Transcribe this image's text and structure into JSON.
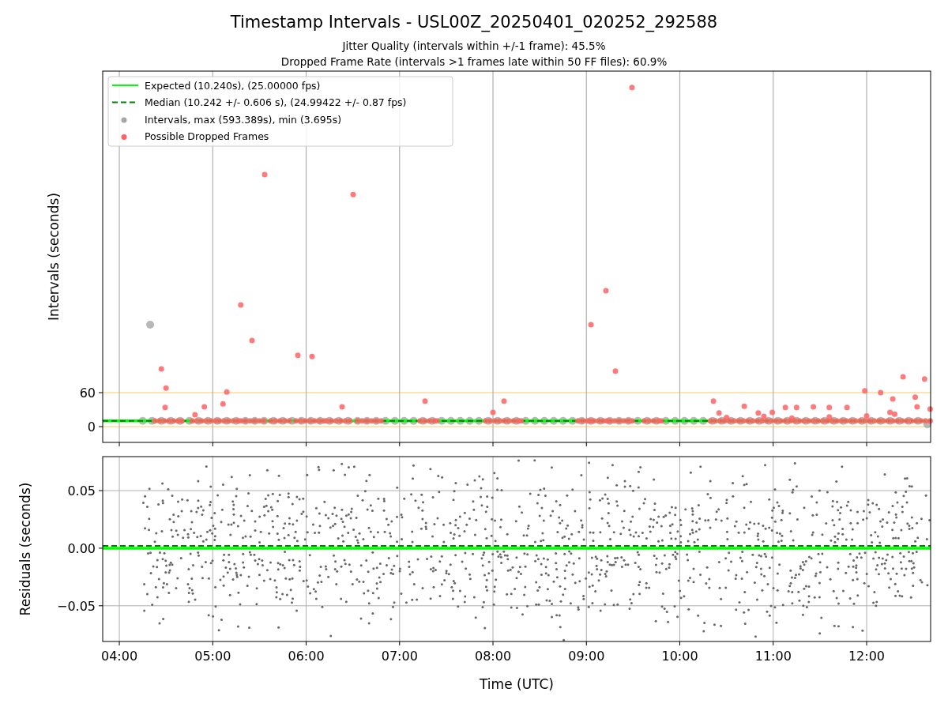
{
  "figure": {
    "title": "Timestamp Intervals - USL00Z_20250401_020252_292588",
    "subtitles": [
      "Jitter Quality (intervals within +/-1 frame): 45.5%",
      "Dropped Frame Rate (intervals >1 frames late within 50 FF files): 60.9%"
    ]
  },
  "intervals_plot": {
    "chart_data": {
      "type": "scatter",
      "ylabel": "Intervals (seconds)",
      "grid": "x",
      "legend": true,
      "xlim": [
        3.822,
        12.685
      ],
      "ylim": [
        -27.9,
        627.9
      ],
      "yticks": [
        {
          "value": 0,
          "label": "0"
        },
        {
          "value": 60,
          "label": "60"
        }
      ],
      "series": [
        {
          "name": "Intervals, max (593.389s), min (3.695s)",
          "color": "#a6a6a6",
          "x": [
            4.25,
            4.35,
            4.45,
            4.55,
            4.65,
            4.75,
            4.85,
            4.95,
            5.05,
            5.15,
            5.25,
            5.35,
            5.45,
            5.55,
            5.65,
            5.75,
            5.85,
            5.95,
            6.05,
            6.15,
            6.25,
            6.35,
            6.45,
            6.55,
            6.65,
            6.75,
            6.85,
            6.95,
            7.05,
            7.15,
            7.25,
            7.35,
            7.45,
            7.55,
            7.65,
            7.75,
            7.85,
            7.95,
            8.05,
            8.15,
            8.25,
            8.35,
            8.45,
            8.55,
            8.65,
            8.75,
            8.85,
            8.95,
            9.05,
            9.15,
            9.25,
            9.35,
            9.45,
            9.55,
            9.65,
            9.75,
            9.85,
            9.95,
            10.05,
            10.15,
            10.25,
            10.35,
            10.45,
            10.55,
            10.65,
            10.75,
            10.85,
            10.95,
            11.05,
            11.15,
            11.25,
            11.35,
            11.45,
            11.55,
            11.65,
            11.75,
            11.85,
            11.95,
            12.05,
            12.15,
            12.25,
            12.35,
            12.45,
            12.55,
            12.65,
            4.33
          ],
          "values": [
            10,
            10,
            10,
            10,
            10,
            10,
            10,
            10,
            10,
            10,
            10,
            10,
            10,
            10,
            10,
            10,
            10,
            10,
            10,
            10,
            10,
            10,
            10,
            10,
            10,
            10,
            10,
            10,
            10,
            10,
            10,
            10,
            10,
            10,
            10,
            10,
            10,
            10,
            10,
            10,
            10,
            10,
            10,
            10,
            10,
            10,
            10,
            10,
            10,
            10,
            10,
            10,
            10,
            10,
            10,
            10,
            10,
            10,
            10,
            10,
            10,
            10,
            10,
            10,
            10,
            10,
            10,
            10,
            10,
            10,
            10,
            10,
            10,
            10,
            10,
            10,
            10,
            10,
            10,
            10,
            10,
            10,
            10,
            10,
            4,
            180
          ]
        },
        {
          "name": "Possible Dropped Frames",
          "color": "#ff6464",
          "x": [
            4.38,
            4.43,
            4.48,
            4.53,
            4.58,
            4.63,
            4.67,
            4.78,
            4.83,
            4.88,
            4.93,
            4.98,
            5.03,
            5.07,
            5.12,
            5.17,
            5.22,
            5.27,
            5.3,
            5.35,
            5.4,
            5.45,
            5.5,
            5.55,
            5.62,
            5.67,
            5.72,
            5.77,
            5.82,
            5.89,
            5.94,
            5.99,
            6.04,
            6.09,
            6.14,
            6.19,
            6.22,
            6.27,
            6.32,
            6.37,
            6.42,
            6.47,
            6.55,
            6.6,
            6.65,
            6.7,
            6.75,
            6.8,
            7.22,
            7.27,
            7.32,
            7.37,
            7.4,
            7.92,
            7.97,
            8.02,
            8.07,
            8.12,
            8.17,
            8.22,
            8.27,
            8.3,
            8.91,
            8.96,
            9.01,
            9.04,
            9.08,
            9.13,
            9.18,
            9.22,
            9.25,
            9.3,
            9.35,
            9.4,
            9.45,
            9.49,
            9.62,
            9.67,
            9.72,
            9.77,
            9.8,
            10.33,
            10.38,
            10.43,
            10.48,
            10.53,
            10.58,
            10.63,
            10.68,
            10.73,
            10.78,
            10.83,
            10.88,
            10.93,
            10.98,
            11.03,
            11.08,
            11.13,
            11.18,
            11.23,
            11.28,
            11.33,
            11.38,
            11.43,
            11.48,
            11.53,
            11.58,
            11.63,
            11.68,
            11.73,
            11.78,
            11.83,
            11.88,
            11.93,
            11.98,
            12.03,
            12.08,
            12.13,
            12.18,
            12.23,
            12.28,
            12.33,
            12.38,
            12.43,
            12.48,
            12.53,
            12.58,
            12.63,
            12.68,
            10.5,
            10.9,
            11.2,
            11.6,
            12.0,
            12.3,
            12.25,
            4.45,
            4.5,
            4.49,
            4.81,
            4.91,
            5.11,
            5.15,
            5.3,
            5.42,
            5.556,
            5.911,
            6.063,
            6.385,
            6.503,
            7.273,
            8.0,
            8.118,
            9.049,
            9.209,
            9.311,
            9.488,
            10.36,
            10.42,
            10.69,
            10.84,
            10.99,
            11.13,
            11.25,
            11.43,
            11.6,
            11.79,
            11.98,
            12.15,
            12.28,
            12.39,
            12.52,
            12.62,
            12.68,
            12.54
          ],
          "values": [
            10,
            10,
            10,
            10,
            10,
            10,
            10,
            10,
            10,
            10,
            10,
            10,
            10,
            10,
            10,
            10,
            10,
            10,
            10,
            10,
            10,
            10,
            10,
            10,
            10,
            10,
            10,
            10,
            10,
            10,
            10,
            10,
            10,
            10,
            10,
            10,
            10,
            10,
            10,
            10,
            10,
            10,
            10,
            10,
            10,
            10,
            10,
            10,
            10,
            10,
            10,
            10,
            10,
            10,
            10,
            10,
            10,
            10,
            10,
            10,
            10,
            10,
            10,
            10,
            10,
            10,
            10,
            10,
            10,
            10,
            10,
            10,
            10,
            10,
            10,
            10,
            10,
            10,
            10,
            10,
            10,
            10,
            10,
            10,
            10,
            10,
            10,
            10,
            10,
            10,
            10,
            10,
            10,
            10,
            10,
            10,
            10,
            10,
            10,
            10,
            10,
            10,
            10,
            10,
            10,
            10,
            10,
            10,
            10,
            10,
            10,
            10,
            10,
            10,
            10,
            10,
            10,
            10,
            10,
            10,
            10,
            10,
            10,
            10,
            10,
            10,
            10,
            10,
            10,
            16,
            18,
            15,
            17,
            19,
            22,
            25,
            102,
            68,
            34,
            21,
            35,
            40,
            61,
            215,
            152,
            445,
            126,
            124,
            35,
            410,
            45,
            25,
            45,
            180,
            240,
            98,
            599,
            45,
            24,
            36,
            24,
            25,
            34,
            34,
            35,
            34,
            34,
            63,
            60,
            49,
            88,
            52,
            84,
            31,
            35
          ]
        }
      ],
      "ref_lines": [
        {
          "axis": "y",
          "value": 10.24,
          "label": "Expected (10.240s), (25.00000 fps)",
          "color": "#00ff00"
        },
        {
          "axis": "y",
          "value": 10.242,
          "label": "Median (10.242 +/- 0.606 s), (24.99422 +/- 0.87 fps)",
          "color": "#008000"
        },
        {
          "axis": "y",
          "value": 0,
          "color": "#ffa500"
        },
        {
          "axis": "y",
          "value": 60,
          "color": "#ffa500"
        }
      ]
    }
  },
  "residuals_plot": {
    "chart_data": {
      "type": "scatter",
      "xlabel": "Time (UTC)",
      "ylabel": "Residuals (seconds)",
      "grid": true,
      "xlim": [
        3.822,
        12.685
      ],
      "ylim": [
        -0.081,
        0.0795
      ],
      "xticks": [
        {
          "value": 4,
          "label": "04:00"
        },
        {
          "value": 5,
          "label": "05:00"
        },
        {
          "value": 6,
          "label": "06:00"
        },
        {
          "value": 7,
          "label": "07:00"
        },
        {
          "value": 8,
          "label": "08:00"
        },
        {
          "value": 9,
          "label": "09:00"
        },
        {
          "value": 10,
          "label": "10:00"
        },
        {
          "value": 11,
          "label": "11:00"
        },
        {
          "value": 12,
          "label": "12:00"
        }
      ],
      "yticks": [
        {
          "value": 0.05,
          "label": "0.05"
        },
        {
          "value": 0,
          "label": "0.00"
        },
        {
          "value": -0.05,
          "label": "−0.05"
        }
      ],
      "ref_lines": [
        {
          "axis": "y",
          "value": 0,
          "color": "#00ff00"
        },
        {
          "axis": "y",
          "value": 0.002,
          "color": "#008000"
        }
      ]
    }
  }
}
